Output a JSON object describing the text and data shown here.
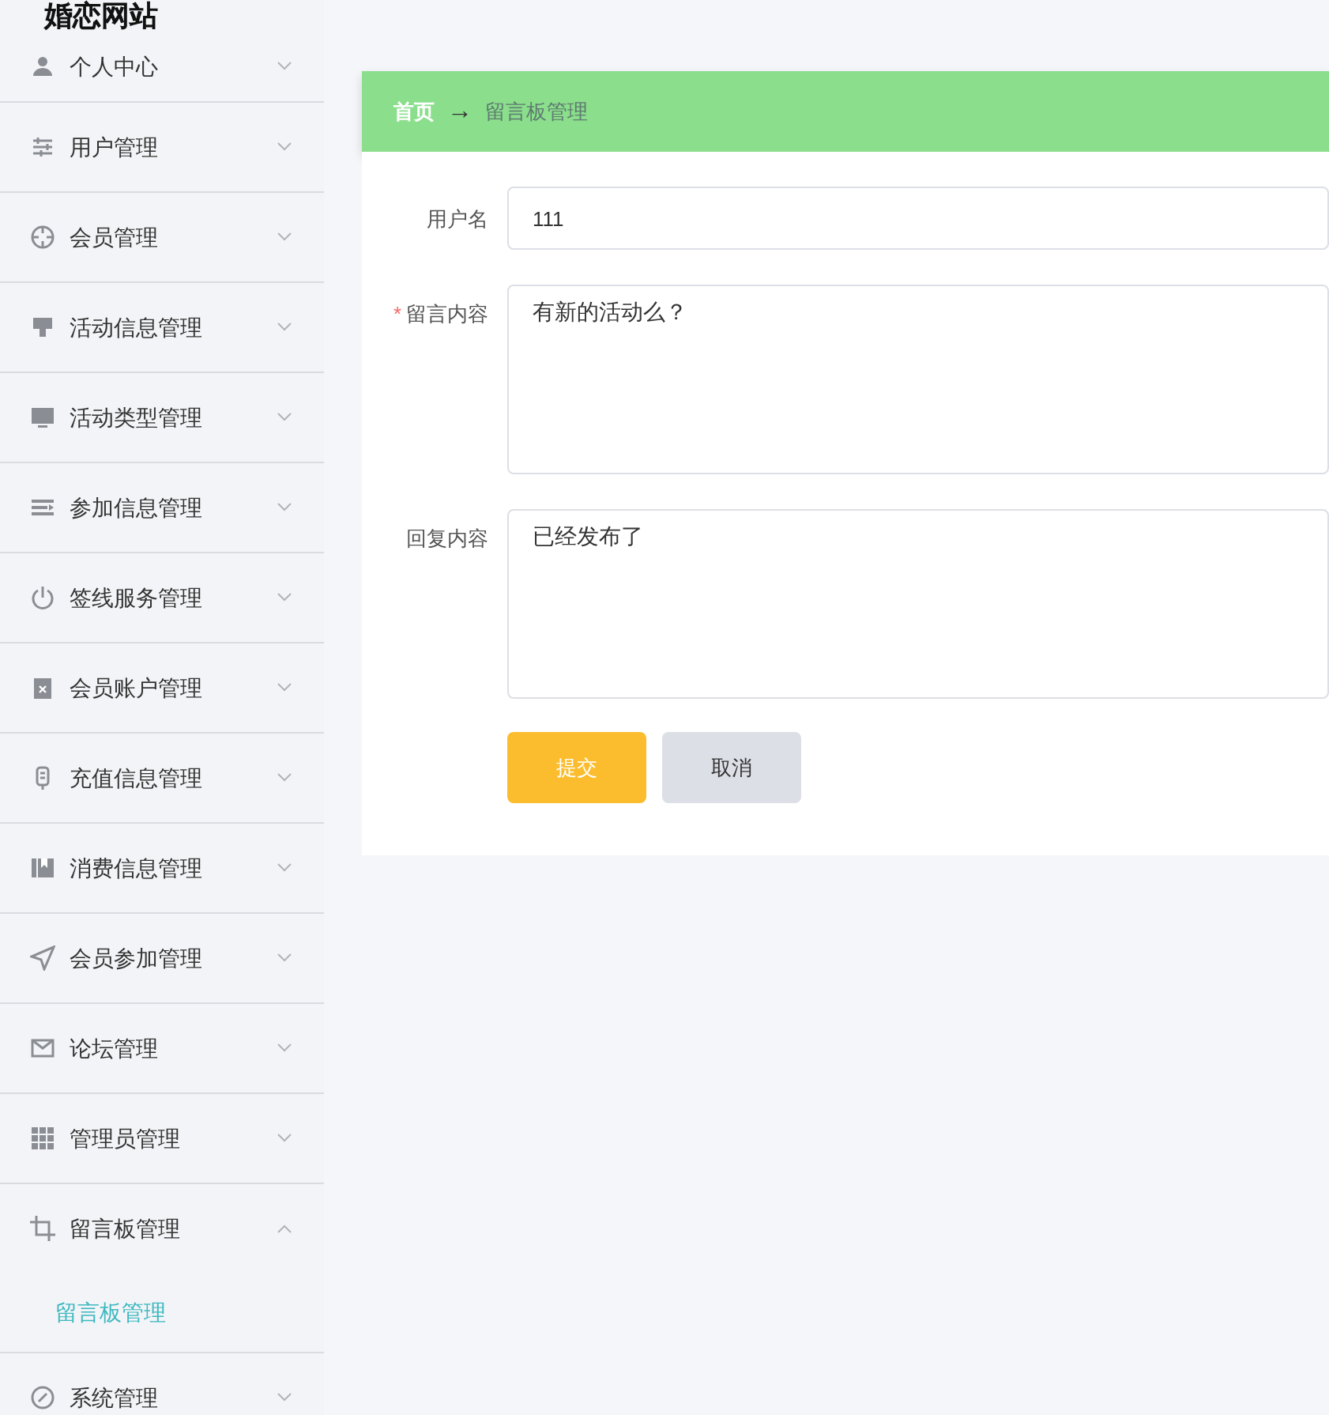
{
  "site_title": "婚恋网站",
  "sidebar": {
    "items": [
      {
        "label": "个人中心",
        "expanded": false
      },
      {
        "label": "用户管理",
        "expanded": false
      },
      {
        "label": "会员管理",
        "expanded": false
      },
      {
        "label": "活动信息管理",
        "expanded": false
      },
      {
        "label": "活动类型管理",
        "expanded": false
      },
      {
        "label": "参加信息管理",
        "expanded": false
      },
      {
        "label": "签线服务管理",
        "expanded": false
      },
      {
        "label": "会员账户管理",
        "expanded": false
      },
      {
        "label": "充值信息管理",
        "expanded": false
      },
      {
        "label": "消费信息管理",
        "expanded": false
      },
      {
        "label": "会员参加管理",
        "expanded": false
      },
      {
        "label": "论坛管理",
        "expanded": false
      },
      {
        "label": "管理员管理",
        "expanded": false
      },
      {
        "label": "留言板管理",
        "expanded": true,
        "children": [
          {
            "label": "留言板管理",
            "selected": true
          }
        ]
      },
      {
        "label": "系统管理",
        "expanded": false
      }
    ]
  },
  "breadcrumb": {
    "home": "首页",
    "separator": "→",
    "current": "留言板管理"
  },
  "form": {
    "fields": [
      {
        "kind": "input",
        "label": "用户名",
        "value": "111"
      },
      {
        "kind": "textarea",
        "label": "留言内容",
        "required_mark": "*",
        "value": "有新的活动么？"
      },
      {
        "kind": "textarea",
        "label": "回复内容",
        "value": "已经发布了"
      }
    ],
    "buttons": [
      {
        "kind": "primary",
        "label": "提交"
      },
      {
        "kind": "secondary",
        "label": "取消"
      }
    ]
  }
}
